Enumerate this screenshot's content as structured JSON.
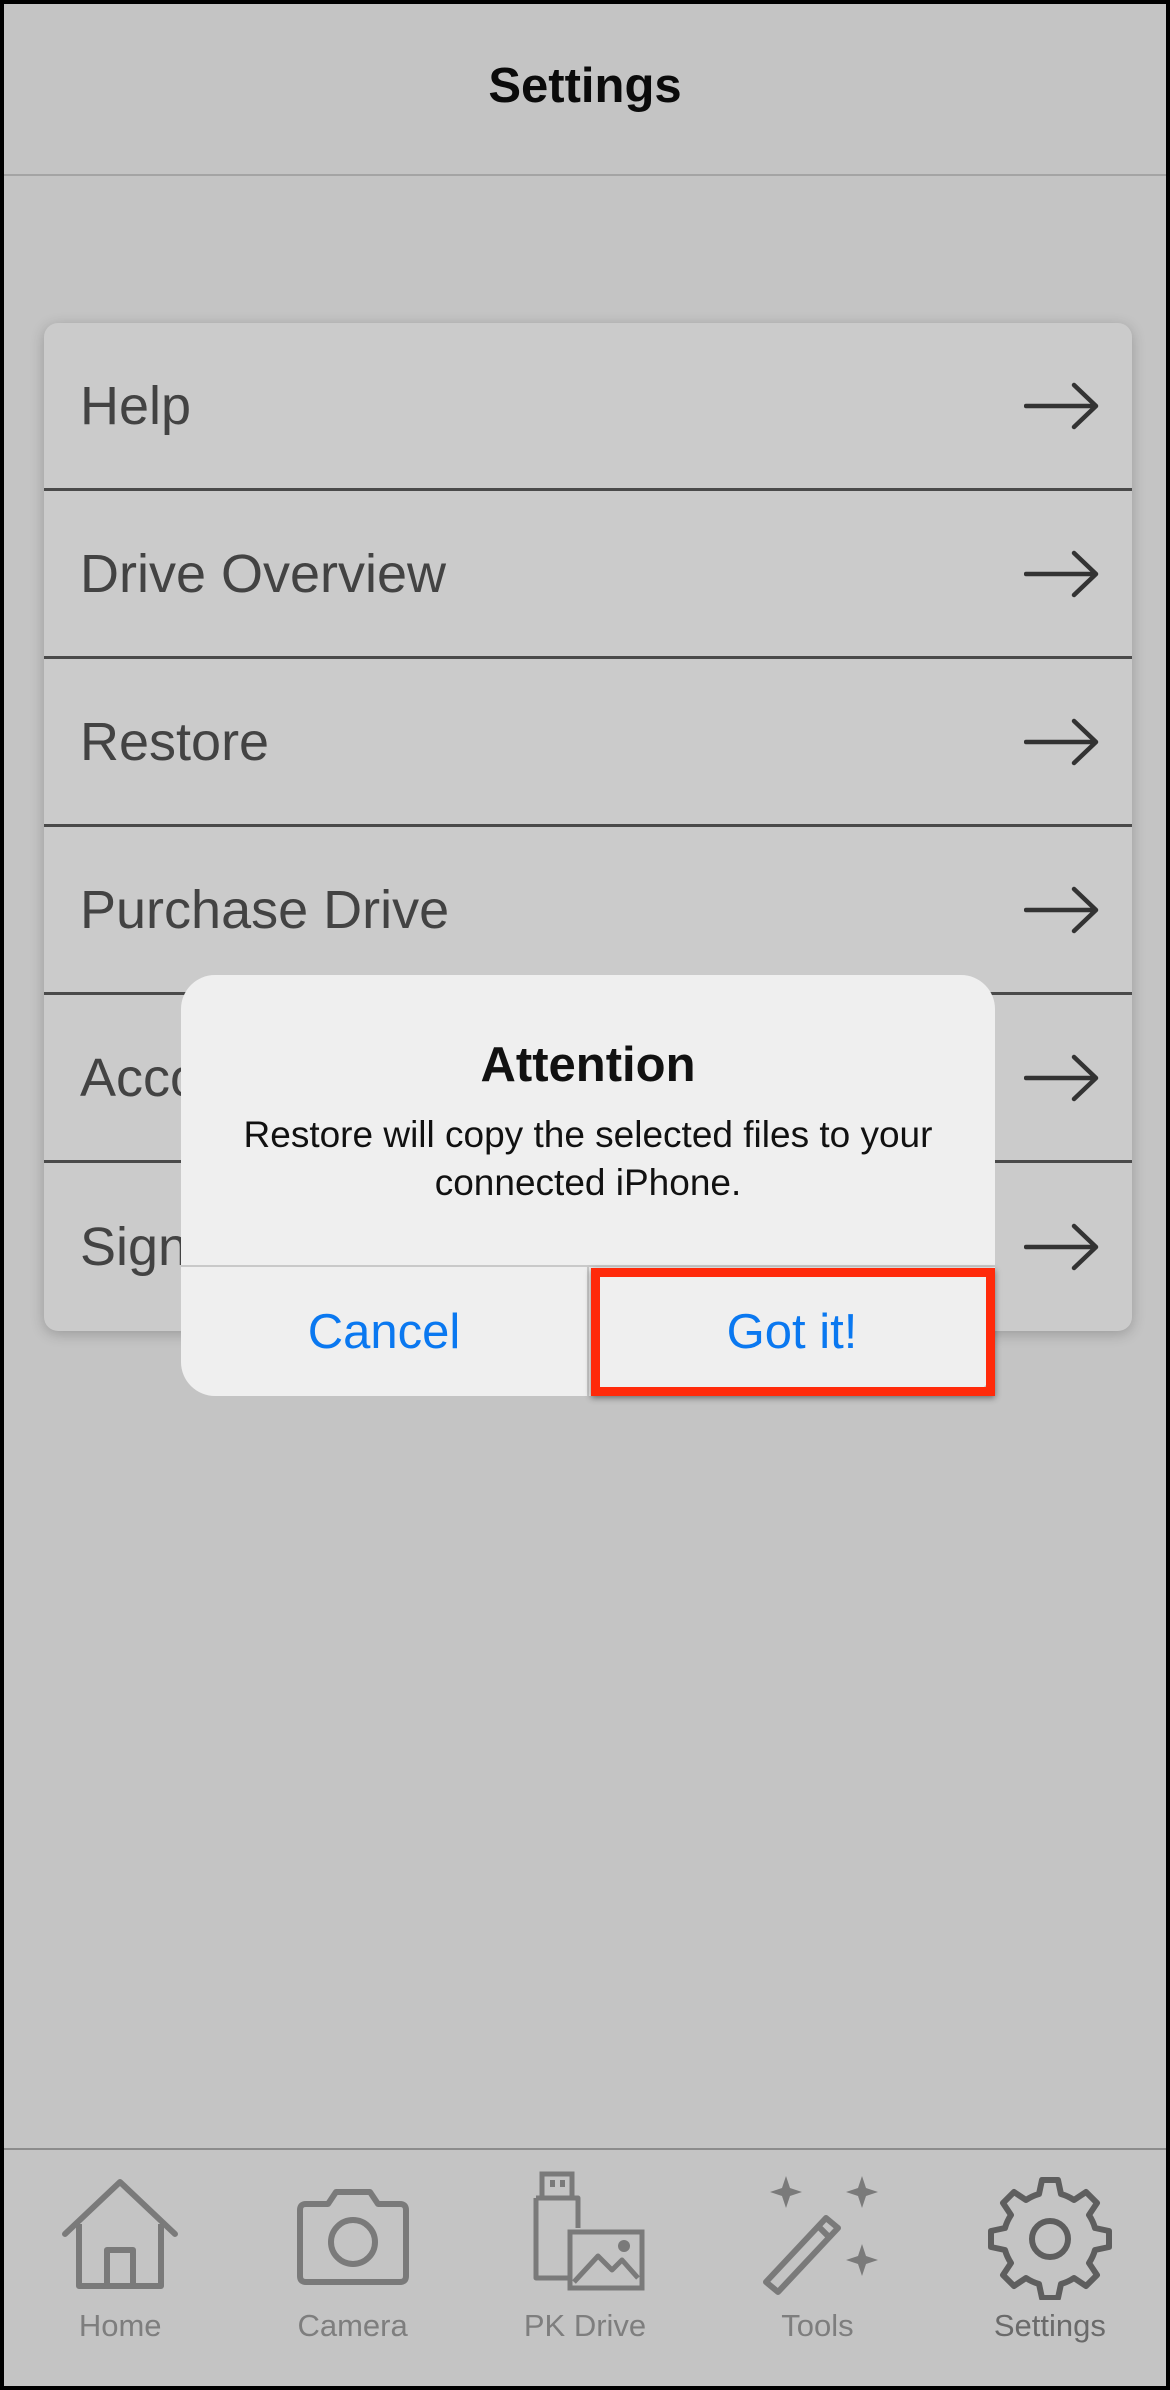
{
  "header": {
    "title": "Settings"
  },
  "menu": {
    "items": [
      {
        "label": "Help",
        "icon": "arrow-right-icon"
      },
      {
        "label": "Drive Overview",
        "icon": "arrow-right-icon"
      },
      {
        "label": "Restore",
        "icon": "arrow-right-icon"
      },
      {
        "label": "Purchase Drive",
        "icon": "arrow-right-icon"
      },
      {
        "label": "Acco",
        "icon": "arrow-right-icon"
      },
      {
        "label": "Sign",
        "icon": "arrow-right-icon"
      }
    ]
  },
  "dialog": {
    "title": "Attention",
    "message": "Restore will copy the selected files to your connected iPhone.",
    "cancel_label": "Cancel",
    "confirm_label": "Got it!",
    "button_color": "#0a78f0"
  },
  "highlight": {
    "color": "#ff2a0a"
  },
  "tab_bar": {
    "tabs": [
      {
        "label": "Home",
        "icon": "home-icon"
      },
      {
        "label": "Camera",
        "icon": "camera-icon"
      },
      {
        "label": "PK Drive",
        "icon": "usb-drive-photo-icon"
      },
      {
        "label": "Tools",
        "icon": "magic-wand-icon"
      },
      {
        "label": "Settings",
        "icon": "gear-icon",
        "active": true
      }
    ]
  }
}
